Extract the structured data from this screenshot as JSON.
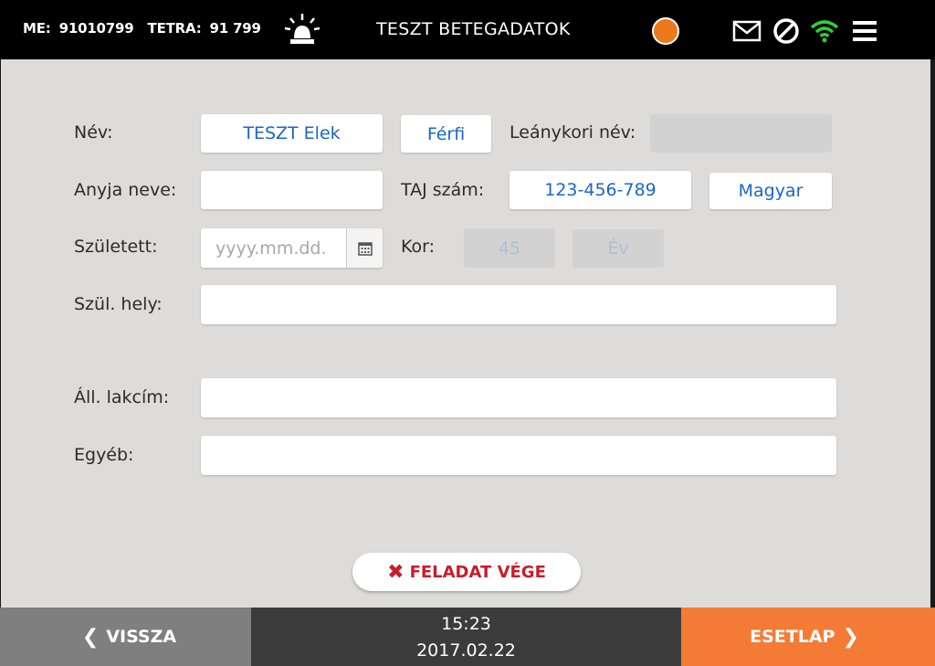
{
  "header": {
    "me_label": "ME:",
    "me_value": "91010799",
    "tetra_label": "TETRA:",
    "tetra_value": "91 799",
    "title": "TESZT BETEGADATOK",
    "status_color": "#ec7a1c",
    "icons": [
      "siren-icon",
      "mail-icon",
      "block-icon",
      "wifi-icon",
      "menu-icon"
    ]
  },
  "form": {
    "name_label": "Név:",
    "name_value": "TESZT Elek",
    "gender_value": "Férfi",
    "maiden_label": "Leánykori név:",
    "maiden_value": "",
    "mother_label": "Anyja neve:",
    "mother_value": "",
    "taj_label": "TAJ szám:",
    "taj_value": "123-456-789",
    "nationality_value": "Magyar",
    "born_label": "Született:",
    "born_placeholder": "yyyy.mm.dd.",
    "age_label": "Kor:",
    "age_value": "45",
    "age_unit": "Év",
    "birthplace_label": "Szül. hely:",
    "birthplace_value": "",
    "address_label": "Áll. lakcím:",
    "address_value": "",
    "other_label": "Egyéb:",
    "other_value": ""
  },
  "actions": {
    "finish_label": "FELADAT VÉGE",
    "back_label": "VISSZA",
    "next_label": "ESETLAP"
  },
  "footer": {
    "time": "15:23",
    "date": "2017.02.22"
  },
  "colors": {
    "accent_orange": "#f47b35",
    "value_blue": "#1a66c7",
    "finish_red": "#c91c2c"
  }
}
